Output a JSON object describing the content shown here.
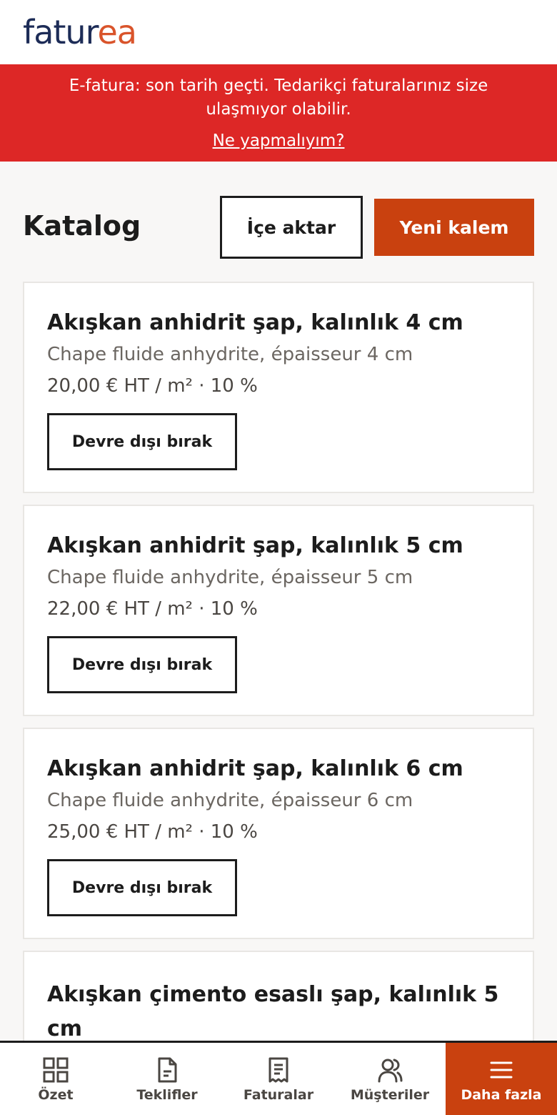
{
  "brand": {
    "logo_part1": "fatur",
    "logo_part2": "ea"
  },
  "alert": {
    "message": "E-fatura: son tarih geçti. Tedarikçi faturalarınız size ulaşmıyor olabilir.",
    "link": "Ne yapmalıyım?"
  },
  "page": {
    "title": "Katalog",
    "import_label": "İçe aktar",
    "new_label": "Yeni kalem"
  },
  "items": [
    {
      "title": "Akışkan anhidrit şap, kalınlık 4 cm",
      "subtitle": "Chape fluide anhydrite, épaisseur 4 cm",
      "price": "20,00 € HT / m² · 10 %",
      "action": "Devre dışı bırak"
    },
    {
      "title": "Akışkan anhidrit şap, kalınlık 5 cm",
      "subtitle": "Chape fluide anhydrite, épaisseur 5 cm",
      "price": "22,00 € HT / m² · 10 %",
      "action": "Devre dışı bırak"
    },
    {
      "title": "Akışkan anhidrit şap, kalınlık 6 cm",
      "subtitle": "Chape fluide anhydrite, épaisseur 6 cm",
      "price": "25,00 € HT / m² · 10 %",
      "action": "Devre dışı bırak"
    },
    {
      "title": "Akışkan çimento esaslı şap, kalınlık 5 cm"
    }
  ],
  "nav": [
    {
      "label": "Özet",
      "icon": "grid-icon"
    },
    {
      "label": "Teklifler",
      "icon": "document-icon"
    },
    {
      "label": "Faturalar",
      "icon": "receipt-icon"
    },
    {
      "label": "Müşteriler",
      "icon": "users-icon"
    },
    {
      "label": "Daha fazla",
      "icon": "menu-icon",
      "active": true
    }
  ],
  "colors": {
    "brand_navy": "#1d2c57",
    "brand_orange": "#d9542b",
    "alert_red": "#dd2726",
    "primary_button": "#c9410f"
  }
}
